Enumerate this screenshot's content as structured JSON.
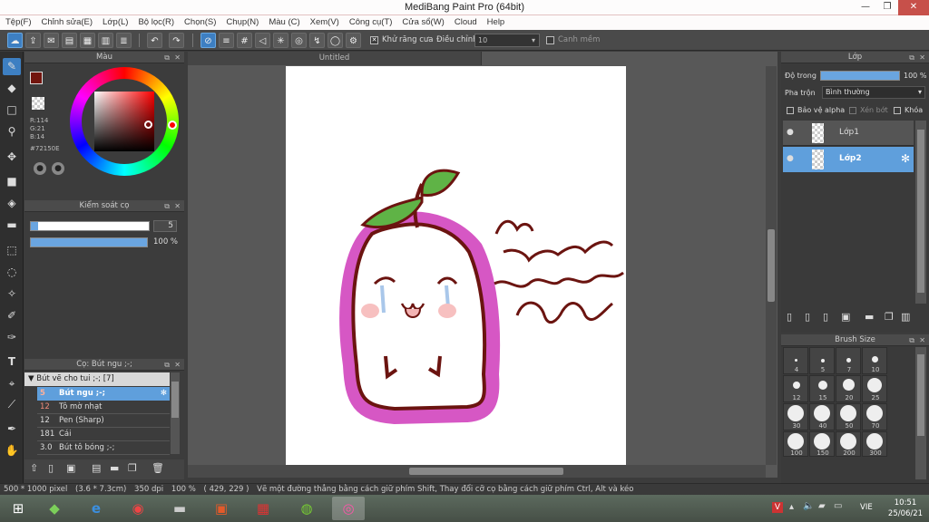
{
  "window": {
    "title": "MediBang Paint Pro (64bit)"
  },
  "menu": [
    "Tệp(F)",
    "Chỉnh sửa(E)",
    "Lớp(L)",
    "Bộ lọc(R)",
    "Chọn(S)",
    "Chụp(N)",
    "Màu (C)",
    "Xem(V)",
    "Công cụ(T)",
    "Cửa sổ(W)",
    "Cloud",
    "Help"
  ],
  "toolbar": {
    "antialias_label": "Khử răng cưa",
    "adjust_label": "Điều chỉnh",
    "brush_value": "10",
    "edge_label": "Canh mềm"
  },
  "color_panel": {
    "title": "Màu",
    "r": "R:114",
    "g": "G:21",
    "b": "B:14",
    "hex": "#72150E",
    "current_color": "#72150E"
  },
  "brush_control": {
    "title": "Kiểm soát cọ",
    "size": "5",
    "opacity": "100 %"
  },
  "brush_panel": {
    "title": "Cọ: Bút ngu ;-;",
    "group": "Bút vẽ cho tui ;-; [7]",
    "items": [
      {
        "size": "5",
        "name": "Bút ngu ;-;"
      },
      {
        "size": "12",
        "name": "Tô mờ nhạt"
      },
      {
        "size": "12",
        "name": "Pen (Sharp)"
      },
      {
        "size": "181",
        "name": "Cái"
      },
      {
        "size": "3.0",
        "name": "Bút tô bóng ;-;"
      }
    ]
  },
  "canvas": {
    "tab": "Untitled"
  },
  "layer_panel": {
    "title": "Lớp",
    "opacity_label": "Độ trong",
    "opacity_value": "100 %",
    "blend_label": "Pha trộn",
    "blend_value": "Bình thường",
    "protect_alpha": "Bảo vệ alpha",
    "clipping": "Xén bớt",
    "lock": "Khóa",
    "layers": [
      {
        "name": "Lớp1"
      },
      {
        "name": "Lớp2"
      }
    ]
  },
  "brush_size_panel": {
    "title": "Brush Size",
    "sizes": [
      "4",
      "5",
      "7",
      "10",
      "12",
      "15",
      "20",
      "25",
      "30",
      "40",
      "50",
      "70",
      "100",
      "150",
      "200",
      "300"
    ]
  },
  "status": {
    "dimensions": "500 * 1000 pixel",
    "cm": "(3.6 * 7.3cm)",
    "dpi": "350 dpi",
    "zoom": "100 %",
    "coords": "( 429, 229 )",
    "hint": "Vẽ một đường thẳng bằng cách giữ phím Shift, Thay đổi cỡ cọ bằng cách giữ phím Ctrl, Alt và kéo"
  },
  "taskbar": {
    "lang": "VIE",
    "time": "10:51",
    "date": "25/06/21"
  }
}
